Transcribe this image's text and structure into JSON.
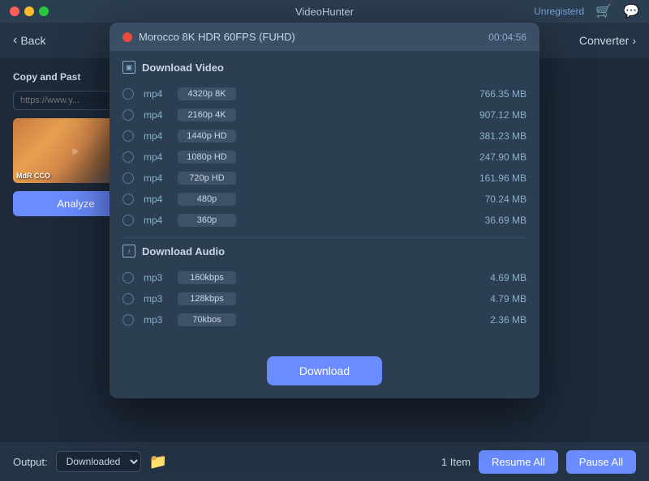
{
  "titleBar": {
    "title": "VideoHunter",
    "unregistered": "Unregisterd",
    "trafficLights": [
      "close",
      "minimize",
      "maximize"
    ]
  },
  "navBar": {
    "backLabel": "Back",
    "converterLabel": "Converter"
  },
  "sidebar": {
    "copyPasteLabel": "Copy and Past",
    "urlPlaceholder": "https://www.y...",
    "analyzeLabel": "Analyze",
    "thumbnailLabel": "MdR CCO"
  },
  "dialog": {
    "redDot": true,
    "videoTitle": "Morocco 8K HDR 60FPS (FUHD)",
    "duration": "00:04:56",
    "videoSection": {
      "title": "Download Video",
      "rows": [
        {
          "type": "mp4",
          "quality": "4320p 8K",
          "size": "766.35 MB"
        },
        {
          "type": "mp4",
          "quality": "2160p 4K",
          "size": "907.12 MB"
        },
        {
          "type": "mp4",
          "quality": "1440p HD",
          "size": "381.23 MB"
        },
        {
          "type": "mp4",
          "quality": "1080p HD",
          "size": "247.90 MB"
        },
        {
          "type": "mp4",
          "quality": "720p HD",
          "size": "161.96 MB"
        },
        {
          "type": "mp4",
          "quality": "480p",
          "size": "70.24 MB"
        },
        {
          "type": "mp4",
          "quality": "360p",
          "size": "36.69 MB"
        }
      ]
    },
    "audioSection": {
      "title": "Download Audio",
      "rows": [
        {
          "type": "mp3",
          "quality": "160kbps",
          "size": "4.69 MB"
        },
        {
          "type": "mp3",
          "quality": "128kbps",
          "size": "4.79 MB"
        },
        {
          "type": "mp3",
          "quality": "70kbos",
          "size": "2.36 MB"
        }
      ]
    },
    "downloadLabel": "Download"
  },
  "bottomBar": {
    "outputLabel": "Output:",
    "outputValue": "Downloaded",
    "itemCount": "1 Item",
    "resumeAllLabel": "Resume All",
    "pauseAllLabel": "Pause All"
  }
}
